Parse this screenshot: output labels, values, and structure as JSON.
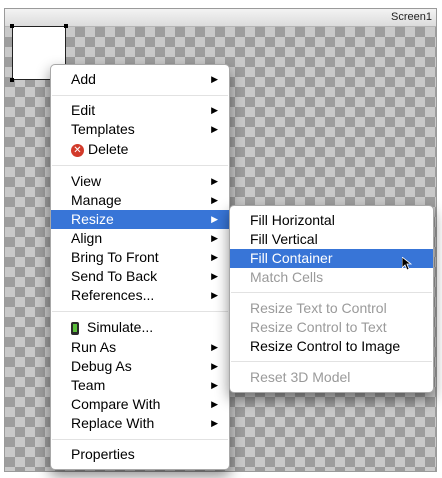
{
  "screen": {
    "title": "Screen1"
  },
  "context_menu": {
    "items": [
      {
        "label": "Add",
        "submenu": true
      },
      {
        "label": "Edit",
        "submenu": true
      },
      {
        "label": "Templates",
        "submenu": true
      },
      {
        "label": "Delete",
        "icon": "delete-icon"
      },
      {
        "label": "View",
        "submenu": true
      },
      {
        "label": "Manage",
        "submenu": true
      },
      {
        "label": "Resize",
        "submenu": true,
        "highlighted": true
      },
      {
        "label": "Align",
        "submenu": true
      },
      {
        "label": "Bring To Front",
        "submenu": true
      },
      {
        "label": "Send To Back",
        "submenu": true
      },
      {
        "label": "References...",
        "submenu": true
      },
      {
        "label": "Simulate...",
        "icon": "phone-icon"
      },
      {
        "label": "Run As",
        "submenu": true
      },
      {
        "label": "Debug As",
        "submenu": true
      },
      {
        "label": "Team",
        "submenu": true
      },
      {
        "label": "Compare With",
        "submenu": true
      },
      {
        "label": "Replace With",
        "submenu": true
      },
      {
        "label": "Properties"
      }
    ],
    "submenu_arrow": "▶"
  },
  "resize_submenu": {
    "items": [
      {
        "label": "Fill Horizontal",
        "enabled": true
      },
      {
        "label": "Fill Vertical",
        "enabled": true
      },
      {
        "label": "Fill Container",
        "enabled": true,
        "highlighted": true
      },
      {
        "label": "Match Cells",
        "enabled": false
      },
      {
        "label": "Resize Text to Control",
        "enabled": false
      },
      {
        "label": "Resize Control to Text",
        "enabled": false
      },
      {
        "label": "Resize Control to Image",
        "enabled": true
      },
      {
        "label": "Reset 3D Model",
        "enabled": false
      }
    ]
  },
  "colors": {
    "highlight": "#3875d7",
    "disabled_text": "#9a9a9a"
  }
}
